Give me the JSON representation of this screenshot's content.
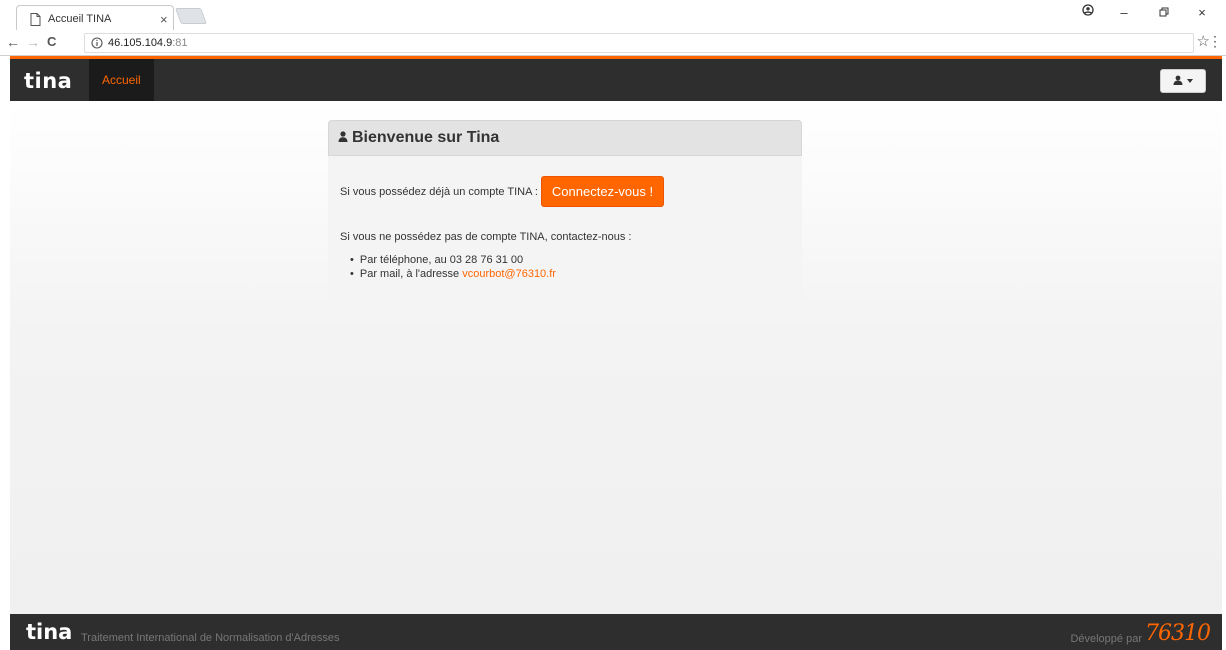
{
  "browser": {
    "tab_title": "Accueil TINA",
    "tab_close": "×",
    "url_host": "46.105.104.9",
    "url_port": ":81",
    "back": "←",
    "forward": "→",
    "reload": "C",
    "star": "☆",
    "menu": "⋮",
    "win_minimize": "–",
    "win_restore": "▫",
    "win_close": "×"
  },
  "navbar": {
    "brand": "tina",
    "nav_item": "Accueil",
    "accent_color": "#ff6600"
  },
  "panel": {
    "title": "Bienvenue sur Tina",
    "account_text": "Si vous possédez déjà un compte TINA :",
    "connect_label": "Connectez-vous !",
    "no_account_text": "Si vous ne possédez pas de compte TINA, contactez-nous :",
    "phone_text": "Par téléphone, au 03 28 76 31 00",
    "mail_text": "Par mail, à l'adresse ",
    "mail_link": "vcourbot@76310.fr"
  },
  "footer": {
    "brand": "tina",
    "tagline": "Traitement International de Normalisation d'Adresses",
    "dev_text": "Développé par",
    "dev_logo": "76310"
  },
  "icons": {
    "tab": "page-icon",
    "omnibox": "info-icon",
    "account": "user-icon",
    "menu": "user-menu-icon"
  }
}
